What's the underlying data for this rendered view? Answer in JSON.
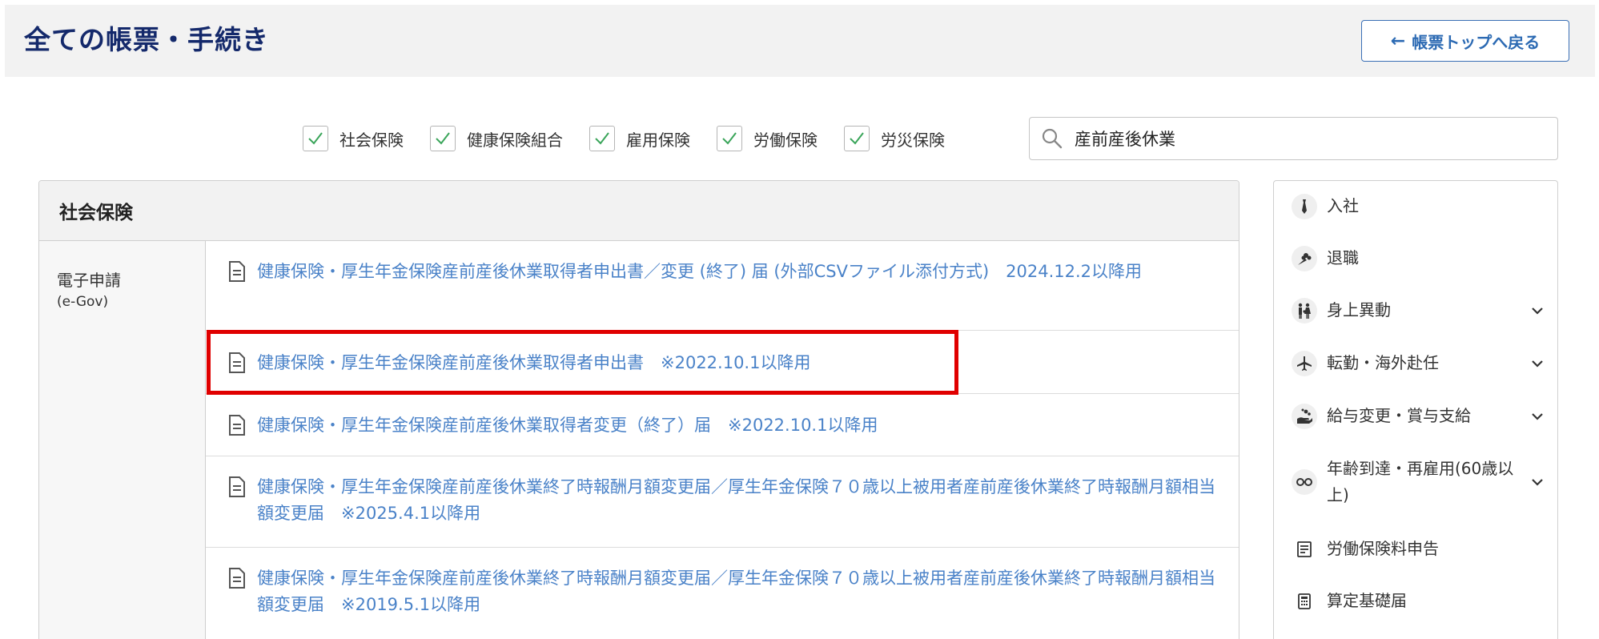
{
  "header": {
    "title": "全ての帳票・手続き",
    "back_label": "帳票トップへ戻る"
  },
  "filters": [
    {
      "label": "社会保険",
      "checked": true
    },
    {
      "label": "健康保険組合",
      "checked": true
    },
    {
      "label": "雇用保険",
      "checked": true
    },
    {
      "label": "労働保険",
      "checked": true
    },
    {
      "label": "労災保険",
      "checked": true
    }
  ],
  "search": {
    "value": "産前産後休業"
  },
  "panel": {
    "title": "社会保険",
    "category": {
      "title": "電子申請",
      "subtitle": "(e-Gov)"
    },
    "items": [
      {
        "label": "健康保険・厚生年金保険産前産後休業取得者申出書／変更 (終了) 届 (外部CSVファイル添付方式)　2024.12.2以降用"
      },
      {
        "label": "健康保険・厚生年金保険産前産後休業取得者申出書　※2022.10.1以降用"
      },
      {
        "label": "健康保険・厚生年金保険産前産後休業取得者変更（終了）届　※2022.10.1以降用"
      },
      {
        "label": "健康保険・厚生年金保険産前産後休業終了時報酬月額変更届／厚生年金保険７０歳以上被用者産前産後休業終了時報酬月額相当額変更届　※2025.4.1以降用"
      },
      {
        "label": "健康保険・厚生年金保険産前産後休業終了時報酬月額変更届／厚生年金保険７０歳以上被用者産前産後休業終了時報酬月額相当額変更届　※2019.5.1以降用"
      }
    ]
  },
  "sidebar": {
    "items": [
      {
        "label": "入社",
        "icon": "necktie-icon",
        "expandable": false
      },
      {
        "label": "退職",
        "icon": "bouquet-icon",
        "expandable": false
      },
      {
        "label": "身上異動",
        "icon": "family-icon",
        "expandable": true
      },
      {
        "label": "転勤・海外赴任",
        "icon": "airplane-icon",
        "expandable": true
      },
      {
        "label": "給与変更・賞与支給",
        "icon": "money-hand-icon",
        "expandable": true
      },
      {
        "label": "年齢到達・再雇用(60歳以上)",
        "icon": "glasses-icon",
        "expandable": true
      },
      {
        "label": "労働保険料申告",
        "icon": "document-lines-icon",
        "expandable": false
      },
      {
        "label": "算定基礎届",
        "icon": "calculator-icon",
        "expandable": false
      }
    ]
  },
  "colors": {
    "title": "#14296b",
    "link": "#4a82c8",
    "check": "#3aa55a",
    "highlight": "#e00000"
  }
}
